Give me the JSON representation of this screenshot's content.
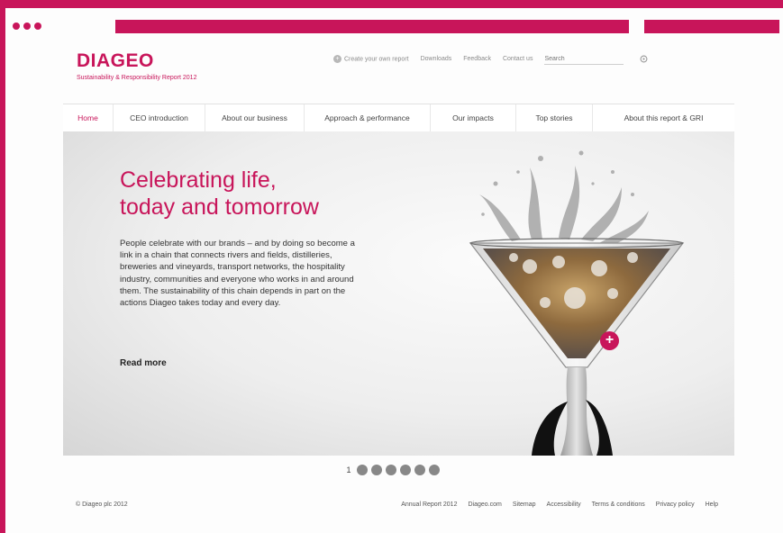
{
  "brand": {
    "logo": "DIAGEO",
    "report_title": "Sustainability & Responsibility Report 2012",
    "accent_color": "#c8155a"
  },
  "utility_nav": {
    "create_report": "Create your own report",
    "downloads": "Downloads",
    "feedback": "Feedback",
    "contact": "Contact us",
    "search_placeholder": "Search"
  },
  "main_nav": {
    "items": [
      {
        "label": "Home"
      },
      {
        "label": "CEO introduction"
      },
      {
        "label": "About our business"
      },
      {
        "label": "Approach & performance"
      },
      {
        "label": "Our impacts"
      },
      {
        "label": "Top stories"
      },
      {
        "label": "About this report & GRI"
      }
    ],
    "active": "Home"
  },
  "hero": {
    "headline_line1": "Celebrating life,",
    "headline_line2": "today and tomorrow",
    "body": "People celebrate with our brands – and by doing so become a link in a chain that connects rivers and fields, distilleries, breweries and vineyards, transport networks, the hospitality industry, communities and everyone who works in and around them. The sustainability of this chain depends in part on the actions Diageo takes today and every day.",
    "read_more": "Read more",
    "plus_symbol": "+"
  },
  "slider": {
    "current": "1",
    "dot_count": 6
  },
  "footer": {
    "copyright": "© Diageo plc 2012",
    "links": [
      "Annual Report 2012",
      "Diageo.com",
      "Sitemap",
      "Accessibility",
      "Terms & conditions",
      "Privacy policy",
      "Help"
    ]
  }
}
